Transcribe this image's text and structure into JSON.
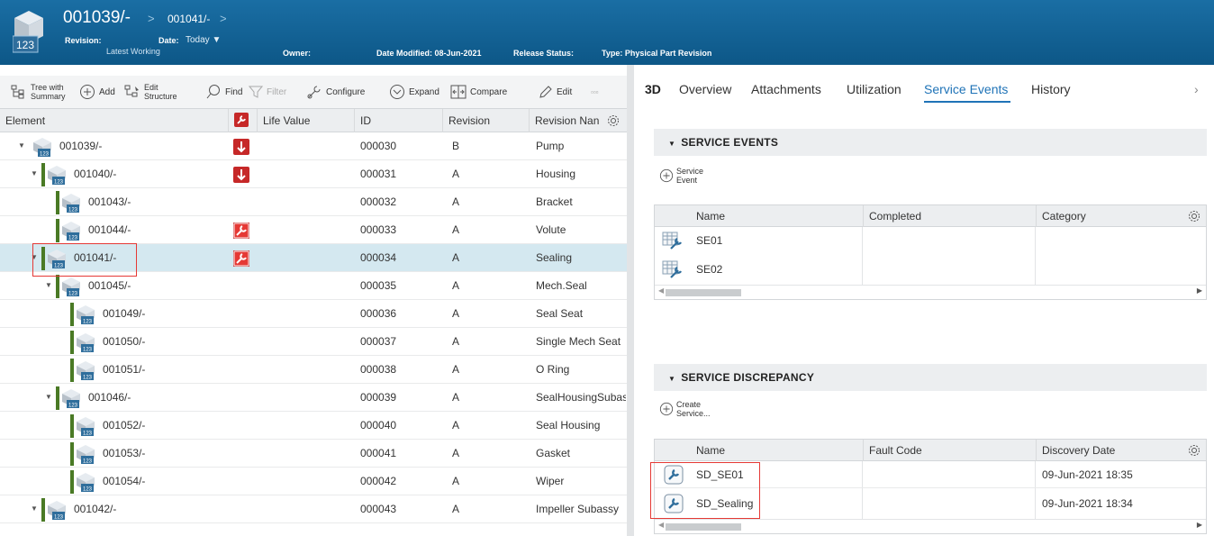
{
  "header": {
    "title": "001039/-",
    "breadcrumb": "001041/-",
    "sep": ">",
    "icon_text": "123",
    "revision_label": "Revision:",
    "revision_value": "Latest Working",
    "date_label": "Date:",
    "date_value": "Today",
    "owner_label": "Owner:",
    "date_modified_label": "Date Modified: 08-Jun-2021",
    "release_label": "Release Status:",
    "type_label": "Type: Physical Part Revision"
  },
  "toolbar": {
    "tree_l1": "Tree with",
    "tree_l2": "Summary",
    "add": "Add",
    "edit_l1": "Edit",
    "edit_l2": "Structure",
    "find": "Find",
    "filter": "Filter",
    "configure": "Configure",
    "expand": "Expand",
    "compare": "Compare",
    "edit": "Edit",
    "more": "▫▫▫"
  },
  "grid": {
    "columns": [
      "Element",
      "",
      "Life Value",
      "ID",
      "Revision",
      "Revision Nan"
    ],
    "rows": [
      {
        "element": "001039/-",
        "id": "000030",
        "rev": "B",
        "name": "Pump",
        "badge": "down",
        "level": 0,
        "toggle": "▼",
        "bar": false
      },
      {
        "element": "001040/-",
        "id": "000031",
        "rev": "A",
        "name": "Housing",
        "badge": "down",
        "level": 1,
        "toggle": "▼",
        "bar": true
      },
      {
        "element": "001043/-",
        "id": "000032",
        "rev": "A",
        "name": "Bracket",
        "badge": "",
        "level": 2,
        "toggle": "",
        "bar": true
      },
      {
        "element": "001044/-",
        "id": "000033",
        "rev": "A",
        "name": "Volute",
        "badge": "wrench",
        "level": 2,
        "toggle": "",
        "bar": true
      },
      {
        "element": "001041/-",
        "id": "000034",
        "rev": "A",
        "name": "Sealing",
        "badge": "wrench",
        "level": 1,
        "toggle": "▼",
        "bar": true,
        "selected": true
      },
      {
        "element": "001045/-",
        "id": "000035",
        "rev": "A",
        "name": "Mech.Seal",
        "badge": "",
        "level": 2,
        "toggle": "▼",
        "bar": true
      },
      {
        "element": "001049/-",
        "id": "000036",
        "rev": "A",
        "name": "Seal Seat",
        "badge": "",
        "level": 3,
        "toggle": "",
        "bar": true
      },
      {
        "element": "001050/-",
        "id": "000037",
        "rev": "A",
        "name": "Single Mech Seat",
        "badge": "",
        "level": 3,
        "toggle": "",
        "bar": true
      },
      {
        "element": "001051/-",
        "id": "000038",
        "rev": "A",
        "name": "O Ring",
        "badge": "",
        "level": 3,
        "toggle": "",
        "bar": true
      },
      {
        "element": "001046/-",
        "id": "000039",
        "rev": "A",
        "name": "SealHousingSubas",
        "badge": "",
        "level": 2,
        "toggle": "▼",
        "bar": true
      },
      {
        "element": "001052/-",
        "id": "000040",
        "rev": "A",
        "name": "Seal Housing",
        "badge": "",
        "level": 3,
        "toggle": "",
        "bar": true
      },
      {
        "element": "001053/-",
        "id": "000041",
        "rev": "A",
        "name": "Gasket",
        "badge": "",
        "level": 3,
        "toggle": "",
        "bar": true
      },
      {
        "element": "001054/-",
        "id": "000042",
        "rev": "A",
        "name": "Wiper",
        "badge": "",
        "level": 3,
        "toggle": "",
        "bar": true
      },
      {
        "element": "001042/-",
        "id": "000043",
        "rev": "A",
        "name": "Impeller Subassy",
        "badge": "",
        "level": 1,
        "toggle": "▼",
        "bar": true
      }
    ]
  },
  "tabs": [
    "3D",
    "Overview",
    "Attachments",
    "Utilization",
    "Service Events",
    "History"
  ],
  "tabs_more": "›",
  "service_events": {
    "title": "SERVICE EVENTS",
    "add_l1": "Service",
    "add_l2": "Event",
    "columns": [
      "Name",
      "Completed",
      "Category"
    ],
    "rows": [
      {
        "name": "SE01",
        "completed": "",
        "category": ""
      },
      {
        "name": "SE02",
        "completed": "",
        "category": ""
      }
    ]
  },
  "service_discrepancy": {
    "title": "SERVICE DISCREPANCY",
    "add_l1": "Create",
    "add_l2": "Service...",
    "columns": [
      "Name",
      "Fault Code",
      "Discovery Date"
    ],
    "rows": [
      {
        "name": "SD_SE01",
        "fault": "",
        "date": "09-Jun-2021 18:35"
      },
      {
        "name": "SD_Sealing",
        "fault": "",
        "date": "09-Jun-2021 18:34"
      }
    ]
  },
  "colors": {
    "accent": "#1f73b7",
    "header": "#0d5787",
    "selected_row": "#d4e8f0",
    "tree_bar": "#4a7a25",
    "badge_red": "#c62828"
  }
}
